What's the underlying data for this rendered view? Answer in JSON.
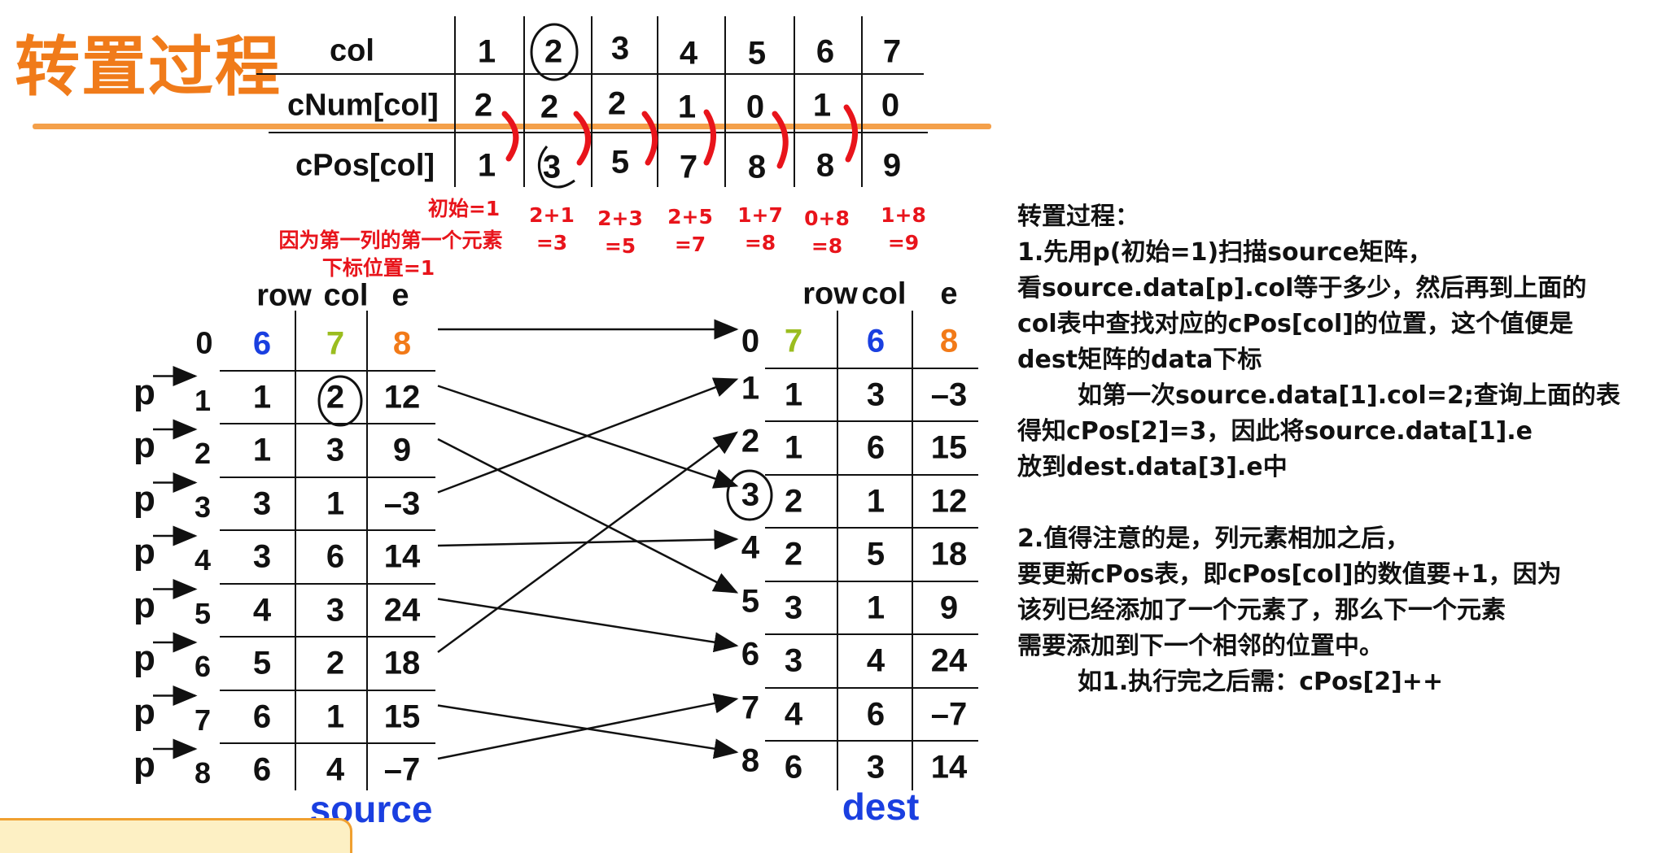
{
  "title": "转置过程",
  "colors": {
    "title": "#f07b1a",
    "note": "#e8141b",
    "blue": "#1a3fe0",
    "green": "#9bbd1f",
    "orange": "#f27a18",
    "pen": "#e8141b"
  },
  "top_table": {
    "row_labels": [
      "col",
      "cNum[col]",
      "cPos[col]"
    ],
    "col": [
      "1",
      "2",
      "3",
      "4",
      "5",
      "6",
      "7"
    ],
    "cNum": [
      "2",
      "2",
      "2",
      "1",
      "0",
      "1",
      "0"
    ],
    "cPos": [
      "1",
      "3",
      "5",
      "7",
      "8",
      "8",
      "9"
    ]
  },
  "notes": {
    "init": "初始=1",
    "reason_line1": "因为第一列的第一个元素",
    "reason_line2": "下标位置=1",
    "sums": [
      [
        "2+1",
        "=3"
      ],
      [
        "2+3",
        "=5"
      ],
      [
        "2+5",
        "=7"
      ],
      [
        "1+7",
        "=8"
      ],
      [
        "0+8",
        "=8"
      ],
      [
        "1+8",
        "=9"
      ]
    ]
  },
  "source": {
    "headers": [
      "row",
      "col",
      "e"
    ],
    "index0": "0",
    "header_vals": [
      "6",
      "7",
      "8"
    ],
    "index_labels": [
      "1",
      "2",
      "3",
      "4",
      "5",
      "6",
      "7",
      "8"
    ],
    "pointer": "p",
    "rows": [
      [
        "1",
        "2",
        "12"
      ],
      [
        "1",
        "3",
        "9"
      ],
      [
        "3",
        "1",
        "–3"
      ],
      [
        "3",
        "6",
        "14"
      ],
      [
        "4",
        "3",
        "24"
      ],
      [
        "5",
        "2",
        "18"
      ],
      [
        "6",
        "1",
        "15"
      ],
      [
        "6",
        "4",
        "–7"
      ]
    ],
    "caption": "source"
  },
  "dest": {
    "headers": [
      "row",
      "col",
      "e"
    ],
    "index0": "0",
    "header_vals": [
      "7",
      "6",
      "8"
    ],
    "index_labels": [
      "1",
      "2",
      "3",
      "4",
      "5",
      "6",
      "7",
      "8"
    ],
    "rows": [
      [
        "1",
        "3",
        "–3"
      ],
      [
        "1",
        "6",
        "15"
      ],
      [
        "2",
        "1",
        "12"
      ],
      [
        "2",
        "5",
        "18"
      ],
      [
        "3",
        "1",
        "9"
      ],
      [
        "3",
        "4",
        "24"
      ],
      [
        "4",
        "6",
        "–7"
      ],
      [
        "6",
        "3",
        "14"
      ]
    ],
    "caption": "dest"
  },
  "explanation": [
    "转置过程：",
    "1.先用p(初始=1)扫描source矩阵，",
    "看source.data[p].col等于多少，然后再到上面的",
    "col表中查找对应的cPos[col]的位置，这个值便是",
    "dest矩阵的data下标",
    "如第一次source.data[1].col=2;查询上面的表",
    "得知cPos[2]=3，因此将source.data[1].e",
    "放到dest.data[3].e中",
    "",
    "2.值得注意的是，列元素相加之后，",
    "要更新cPos表，即cPos[col]的数值要+1，因为",
    "该列已经添加了一个元素了，那么下一个元素",
    "需要添加到下一个相邻的位置中。",
    "如1.执行完之后需：cPos[2]++"
  ],
  "arrows": [
    [
      0,
      0
    ],
    [
      1,
      3
    ],
    [
      2,
      5
    ],
    [
      3,
      1
    ],
    [
      4,
      4
    ],
    [
      5,
      6
    ],
    [
      6,
      2
    ],
    [
      7,
      8
    ],
    [
      8,
      7
    ]
  ]
}
